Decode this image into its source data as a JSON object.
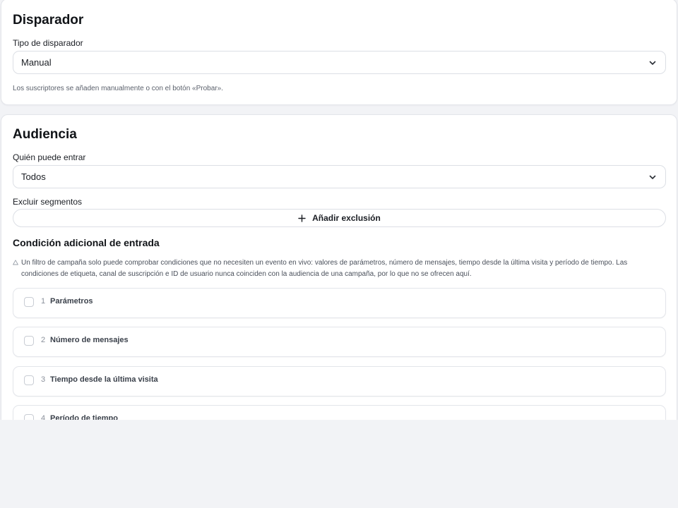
{
  "trigger": {
    "title": "Disparador",
    "type_label": "Tipo de disparador",
    "type_value": "Manual",
    "helper": "Los suscriptores se añaden manualmente o con el botón «Probar»."
  },
  "audience": {
    "title": "Audiencia",
    "who_label": "Quién puede entrar",
    "who_value": "Todos",
    "exclude_label": "Excluir segmentos",
    "add_exclusion": "Añadir exclusión",
    "extra_title": "Condición adicional de entrada",
    "note": "Un filtro de campaña solo puede comprobar condiciones que no necesiten un evento en vivo: valores de parámetros, número de mensajes, tiempo desde la última visita y período de tiempo. Las condiciones de etiqueta, canal de suscripción e ID de usuario nunca coinciden con la audiencia de una campaña, por lo que no se ofrecen aquí.",
    "conditions": [
      {
        "num": "1",
        "label": "Parámetros",
        "checked": false
      },
      {
        "num": "2",
        "label": "Número de mensajes",
        "checked": false
      },
      {
        "num": "3",
        "label": "Tiempo desde la última visita",
        "checked": false
      },
      {
        "num": "4",
        "label": "Período de tiempo",
        "checked": false
      }
    ]
  },
  "icons": {
    "select_chevron": "chevron-down-icon",
    "add": "plus-icon",
    "note": "warning-triangle-icon"
  }
}
